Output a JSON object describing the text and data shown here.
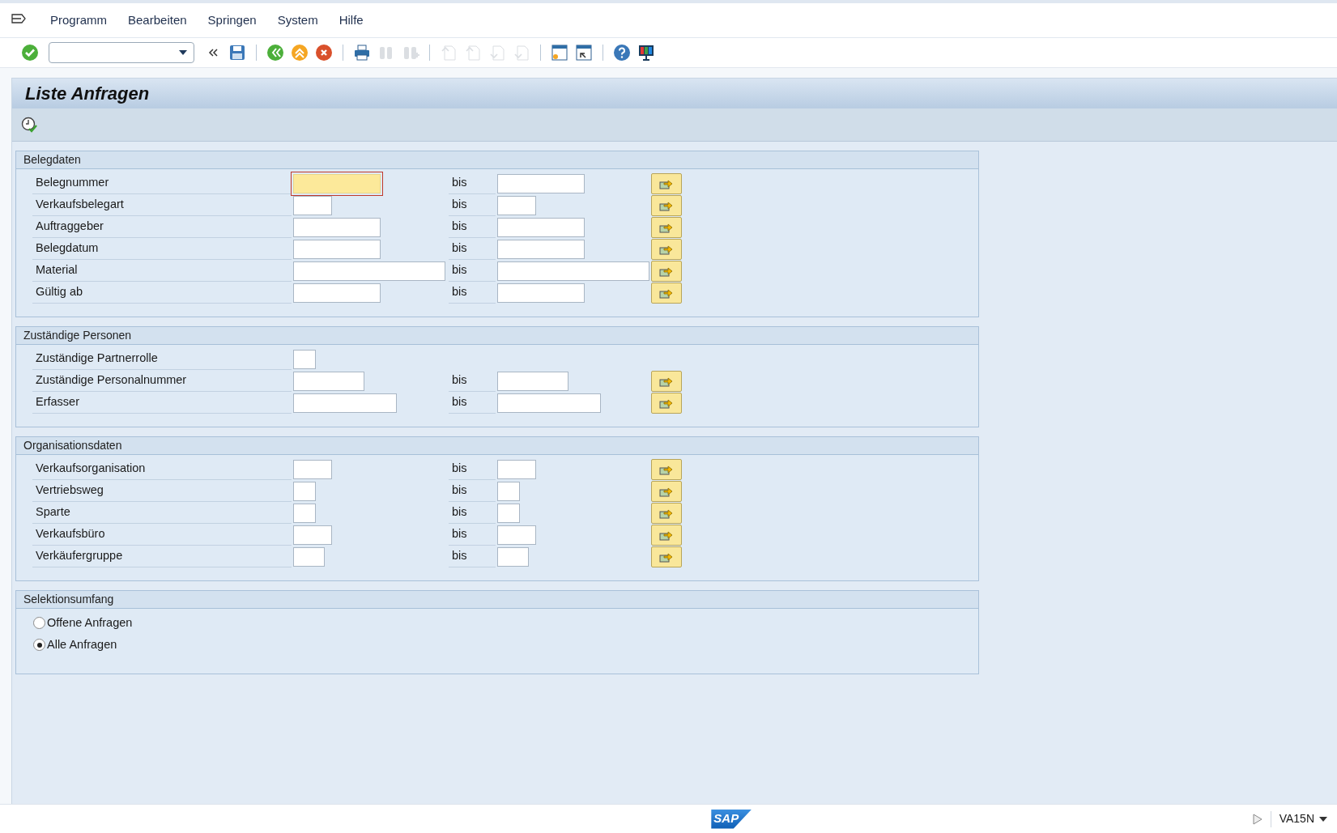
{
  "menu": [
    {
      "label": "Programm"
    },
    {
      "label": "Bearbeiten"
    },
    {
      "label": "Springen"
    },
    {
      "label": "System"
    },
    {
      "label": "Hilfe"
    }
  ],
  "toolbar": [
    {
      "kind": "enter",
      "disabled": false
    },
    {
      "kind": "command"
    },
    {
      "kind": "collapse"
    },
    {
      "kind": "save",
      "disabled": false
    },
    {
      "kind": "sep"
    },
    {
      "kind": "back",
      "disabled": false
    },
    {
      "kind": "exit",
      "disabled": false
    },
    {
      "kind": "cancel",
      "disabled": false
    },
    {
      "kind": "sep"
    },
    {
      "kind": "print",
      "disabled": false
    },
    {
      "kind": "find",
      "disabled": true
    },
    {
      "kind": "findnext",
      "disabled": true
    },
    {
      "kind": "sep"
    },
    {
      "kind": "first",
      "disabled": true
    },
    {
      "kind": "prev",
      "disabled": true
    },
    {
      "kind": "next",
      "disabled": true
    },
    {
      "kind": "last",
      "disabled": true
    },
    {
      "kind": "sep"
    },
    {
      "kind": "newsession",
      "disabled": false
    },
    {
      "kind": "shortcut",
      "disabled": false
    },
    {
      "kind": "sep"
    },
    {
      "kind": "help",
      "disabled": false
    },
    {
      "kind": "layout",
      "disabled": false
    }
  ],
  "title": "Liste Anfragen",
  "groups": [
    {
      "title": "Belegdaten",
      "rows": [
        {
          "label": "Belegnummer",
          "focused": true,
          "bis": "bis"
        },
        {
          "label": "Verkaufsbelegart",
          "focused": false,
          "bis": "bis"
        },
        {
          "label": "Auftraggeber",
          "focused": false,
          "bis": "bis"
        },
        {
          "label": "Belegdatum",
          "focused": false,
          "bis": "bis"
        },
        {
          "label": "Material",
          "focused": false,
          "bis": "bis"
        },
        {
          "label": "Gültig ab",
          "focused": false,
          "bis": "bis"
        }
      ]
    },
    {
      "title": "Zuständige Personen",
      "rows": [
        {
          "label": "Zuständige Partnerrolle",
          "focused": false
        },
        {
          "label": "Zuständige Personalnummer",
          "focused": false,
          "bis": "bis"
        },
        {
          "label": "Erfasser",
          "focused": false,
          "bis": "bis"
        }
      ]
    },
    {
      "title": "Organisationsdaten",
      "rows": [
        {
          "label": "Verkaufsorganisation",
          "focused": false,
          "bis": "bis"
        },
        {
          "label": "Vertriebsweg",
          "focused": false,
          "bis": "bis"
        },
        {
          "label": "Sparte",
          "focused": false,
          "bis": "bis"
        },
        {
          "label": "Verkaufsbüro",
          "focused": false,
          "bis": "bis"
        },
        {
          "label": "Verkäufergruppe",
          "focused": false,
          "bis": "bis"
        }
      ]
    }
  ],
  "selection": {
    "title": "Selektionsumfang",
    "options": [
      {
        "label": "Offene Anfragen",
        "selected": false
      },
      {
        "label": "Alle Anfragen",
        "selected": true
      }
    ]
  },
  "status": {
    "logo": "SAP",
    "transaction": "VA15N"
  }
}
